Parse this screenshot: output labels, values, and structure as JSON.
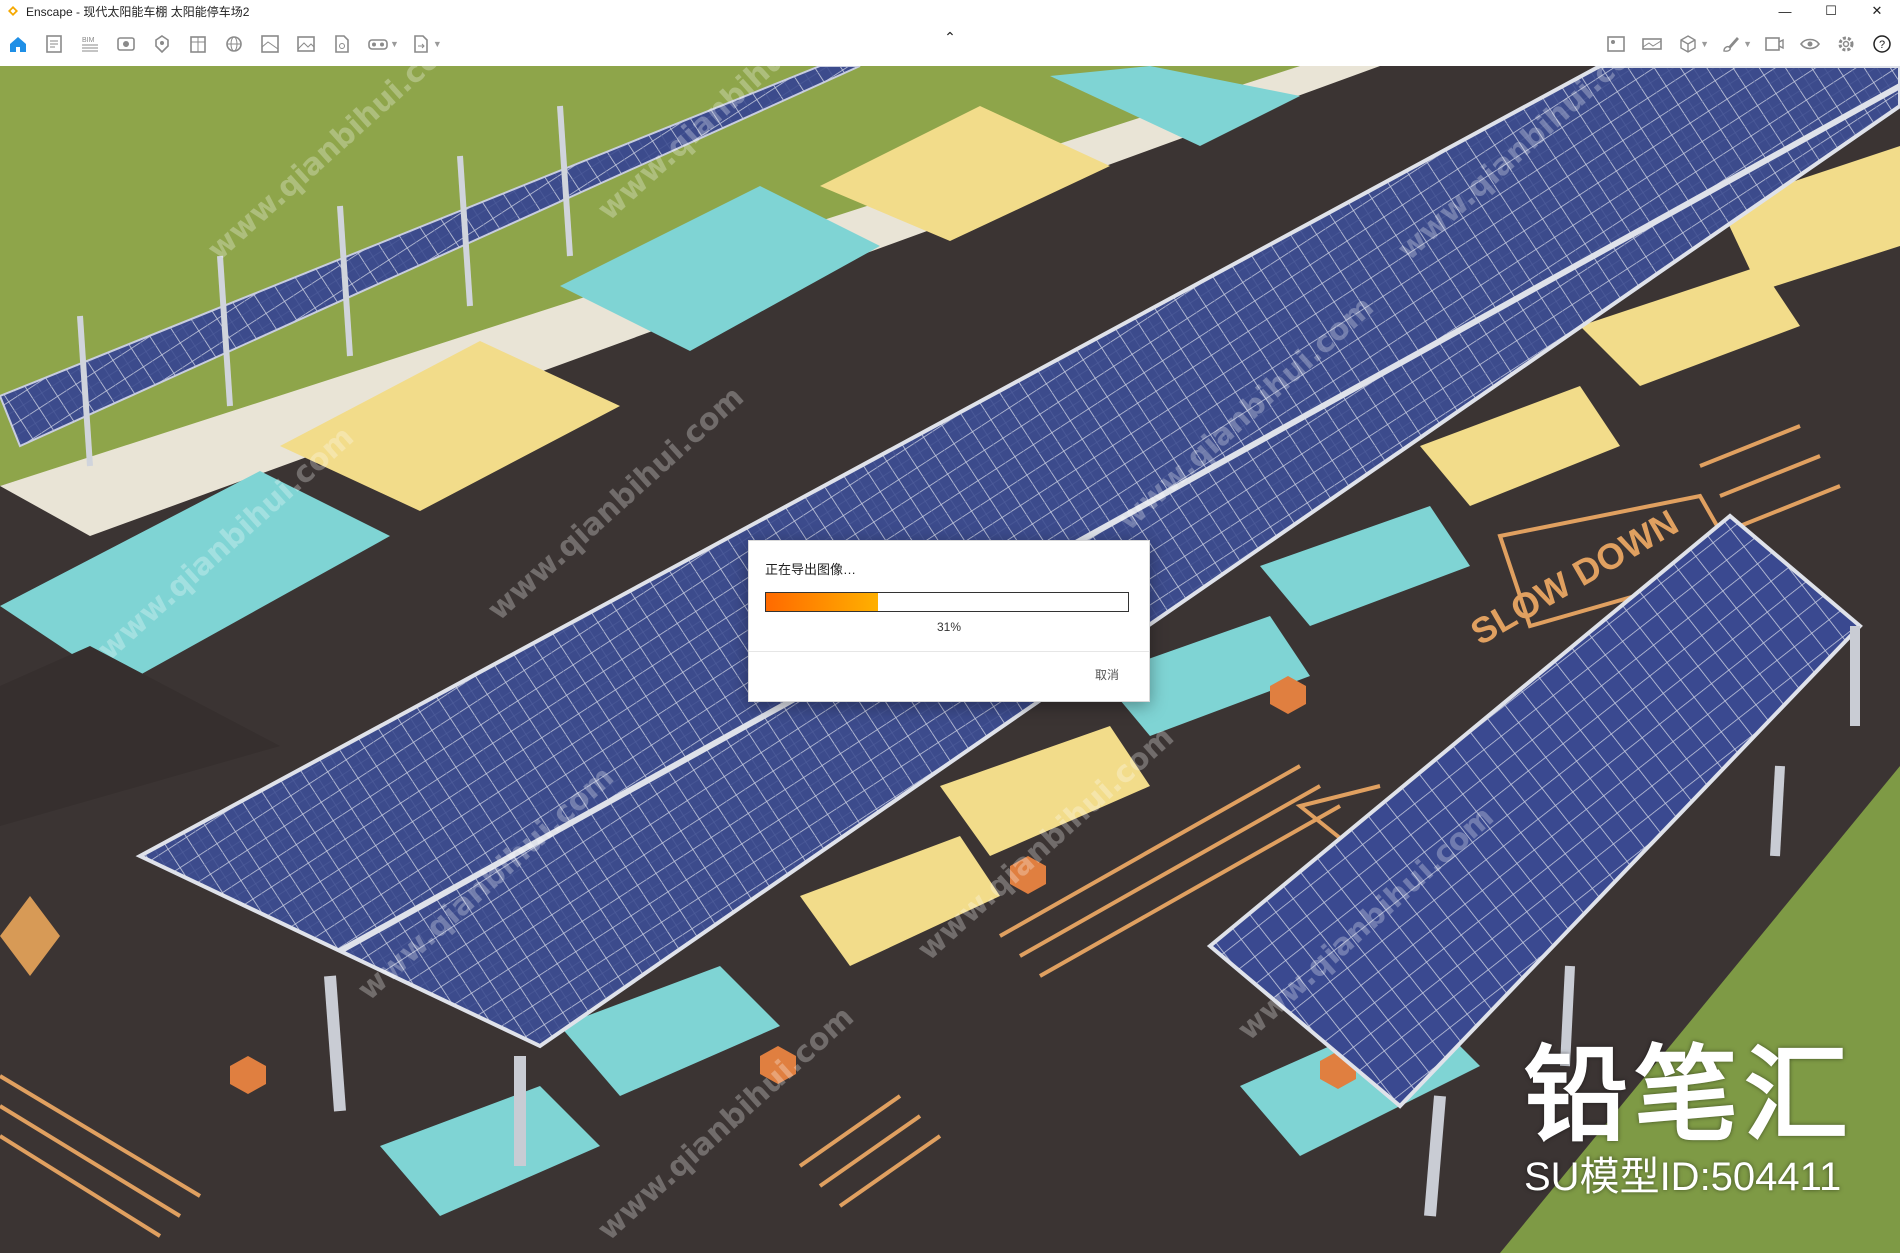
{
  "window": {
    "app_name": "Enscape",
    "title": "Enscape - 现代太阳能车棚 太阳能停车场2",
    "controls": {
      "minimize": "—",
      "maximize": "☐",
      "close": "✕"
    },
    "accent": "#f5a800"
  },
  "toolbar": {
    "left_icons": [
      "home-icon",
      "document-icon",
      "bim-icon",
      "eye-icon",
      "pin-icon",
      "building-icon",
      "globe-icon",
      "material-icon",
      "image-icon",
      "settings-file-icon",
      "vr-headset-icon",
      "export-icon"
    ],
    "right_icons": [
      "image-frame-icon",
      "panorama-icon",
      "cube-icon",
      "brush-icon",
      "capture-icon",
      "visibility-icon",
      "gear-icon",
      "help-icon"
    ],
    "bim_label": "BIM",
    "collapse_glyph": "⌃",
    "help_glyph": "?"
  },
  "dialog": {
    "title": "正在导出图像…",
    "progress_fraction": 0.31,
    "progress_text": "31%",
    "cancel_label": "取消"
  },
  "scene": {
    "road_marking_text": "SLOW DOWN",
    "colors": {
      "grass": "#8ea54a",
      "asphalt": "#3b3433",
      "cyan": "#7fd4d4",
      "yellow": "#f2dc8a",
      "orange_line": "#e0a060",
      "panel": "#3c4b8c"
    }
  },
  "watermark": {
    "brand": "铅笔汇",
    "model_id": "SU模型ID:504411",
    "repeat": "www.qianbihui.com"
  }
}
